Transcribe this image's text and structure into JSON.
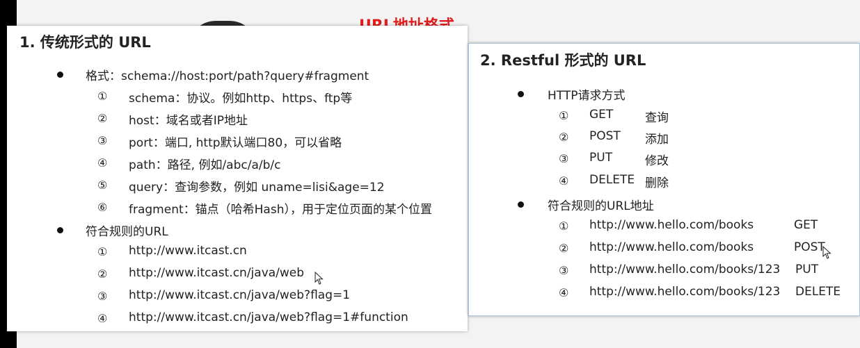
{
  "main_title": "URL地址格式",
  "left": {
    "title": "1. 传统形式的 URL",
    "format": "格式：schema://host:port/path?query#fragment",
    "format_items": [
      {
        "num": "①",
        "text": "schema：协议。例如http、https、ftp等"
      },
      {
        "num": "②",
        "text": "host：域名或者IP地址"
      },
      {
        "num": "③",
        "text": "port：端口, http默认端口80，可以省略"
      },
      {
        "num": "④",
        "text": "path：路径, 例如/abc/a/b/c"
      },
      {
        "num": "⑤",
        "text": "query：查询参数，例如 uname=lisi&age=12"
      },
      {
        "num": "⑥",
        "text": "fragment：锚点（哈希Hash），用于定位页面的某个位置"
      }
    ],
    "rules": "符合规则的URL",
    "rule_items": [
      {
        "num": "①",
        "text": "http://www.itcast.cn"
      },
      {
        "num": "②",
        "text": "http://www.itcast.cn/java/web"
      },
      {
        "num": "③",
        "text": "http://www.itcast.cn/java/web?flag=1"
      },
      {
        "num": "④",
        "text": "http://www.itcast.cn/java/web?flag=1#function"
      }
    ]
  },
  "right": {
    "title": "2. Restful 形式的 URL",
    "methods": "HTTP请求方式",
    "method_items": [
      {
        "num": "①",
        "method": "GET",
        "desc": "查询"
      },
      {
        "num": "②",
        "method": "POST",
        "desc": "添加"
      },
      {
        "num": "③",
        "method": "PUT",
        "desc": "修改"
      },
      {
        "num": "④",
        "method": "DELETE",
        "desc": "删除"
      }
    ],
    "rules": "符合规则的URL地址",
    "rule_items": [
      {
        "num": "①",
        "url": "http://www.hello.com/books",
        "method": "GET"
      },
      {
        "num": "②",
        "url": "http://www.hello.com/books",
        "method": "POST"
      },
      {
        "num": "③",
        "url": "http://www.hello.com/books/123",
        "method": "PUT"
      },
      {
        "num": "④",
        "url": "http://www.hello.com/books/123",
        "method": "DELETE"
      }
    ]
  }
}
